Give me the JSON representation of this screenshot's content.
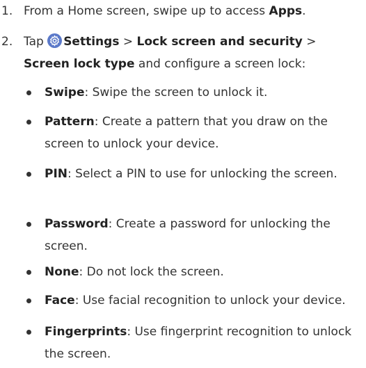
{
  "steps": [
    {
      "number": "1.",
      "pre": "From a Home screen, swipe up to access ",
      "bold": "Apps",
      "post": "."
    },
    {
      "number": "2.",
      "tap": "Tap ",
      "settings": "Settings",
      "sep1": " > ",
      "lock": "Lock screen and security",
      "sep2": " >",
      "type": "Screen lock type",
      "post": " and configure a screen lock:",
      "icon": "settings-gear-icon"
    }
  ],
  "options": [
    {
      "name": "Swipe",
      "desc": ": Swipe the screen to unlock it."
    },
    {
      "name": "Pattern",
      "desc": ": Create a pattern that you draw on the screen to unlock your device."
    },
    {
      "name": "PIN",
      "desc": ": Select a PIN to use for unlocking the screen."
    },
    {
      "name": "Password",
      "desc": ": Create a password for unlocking the screen."
    },
    {
      "name": "None",
      "desc": ": Do not lock the screen."
    },
    {
      "name": "Face",
      "desc": ": Use facial recognition to unlock your device."
    },
    {
      "name": "Fingerprints",
      "desc": ": Use fingerprint recognition to unlock the screen."
    }
  ],
  "colors": {
    "text": "#333333",
    "icon_bg": "#5b79c9"
  }
}
